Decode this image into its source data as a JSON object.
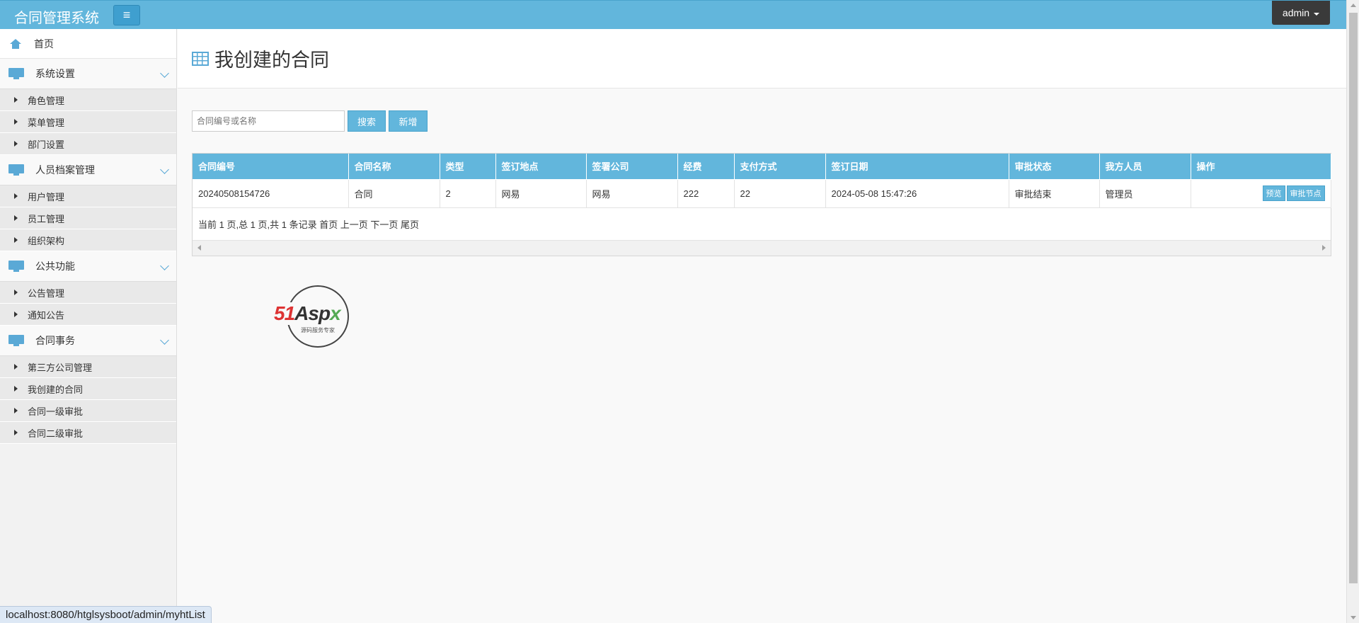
{
  "app": {
    "title": "合同管理系统",
    "menu_toggle_icon": "≡",
    "user": "admin"
  },
  "sidebar": {
    "home": "首页",
    "groups": [
      {
        "label": "系统设置",
        "items": [
          "角色管理",
          "菜单管理",
          "部门设置"
        ]
      },
      {
        "label": "人员档案管理",
        "items": [
          "用户管理",
          "员工管理",
          "组织架构"
        ]
      },
      {
        "label": "公共功能",
        "items": [
          "公告管理",
          "通知公告"
        ]
      },
      {
        "label": "合同事务",
        "items": [
          "第三方公司管理",
          "我创建的合同",
          "合同一级审批",
          "合同二级审批"
        ]
      }
    ]
  },
  "page": {
    "title": "我创建的合同",
    "search_placeholder": "合同编号或名称",
    "search_button": "搜索",
    "add_button": "新增"
  },
  "table": {
    "columns": [
      "合同编号",
      "合同名称",
      "类型",
      "签订地点",
      "签署公司",
      "经费",
      "支付方式",
      "签订日期",
      "审批状态",
      "我方人员",
      "操作"
    ],
    "rows": [
      {
        "cells": [
          "20240508154726",
          "合同",
          "2",
          "网易",
          "网易",
          "222",
          "22",
          "2024-05-08 15:47:26",
          "审批结束",
          "管理员"
        ],
        "actions": [
          "预览",
          "审批节点"
        ]
      }
    ],
    "pager": "当前 1 页,总 1 页,共 1 条记录 首页 上一页 下一页 尾页"
  },
  "logo": {
    "brand_a": "51",
    "brand_b": "Asp",
    "brand_c": "x",
    "tagline": "源码服务专家"
  },
  "status_url": "localhost:8080/htglsysboot/admin/myhtList",
  "colors": {
    "accent": "#62b6dc",
    "topbar": "#62b6dc",
    "admin_bg": "#3a3a3a"
  }
}
